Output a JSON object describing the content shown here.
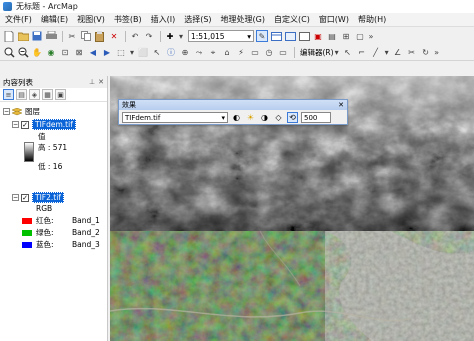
{
  "window": {
    "title": "无标题 - ArcMap"
  },
  "menu": [
    "文件(F)",
    "编辑(E)",
    "视图(V)",
    "书签(B)",
    "插入(I)",
    "选择(S)",
    "地理处理(G)",
    "自定义(C)",
    "窗口(W)",
    "帮助(H)"
  ],
  "toolbar": {
    "scale_value": "1:51,015",
    "editor_label": "编辑器(R)"
  },
  "toc": {
    "title": "内容列表",
    "layers_label": "图层",
    "layer1": {
      "name": "TIFdem.tif",
      "value_label": "值",
      "high": "高 : 571",
      "low": "低 : 16"
    },
    "layer2": {
      "name": "TIF2.tif",
      "rgb_label": "RGB",
      "bands": [
        {
          "label": "红色:",
          "band": "Band_1",
          "color": "#ff0000"
        },
        {
          "label": "绿色:",
          "band": "Band_2",
          "color": "#00c000"
        },
        {
          "label": "蓝色:",
          "band": "Band_3",
          "color": "#0000ff"
        }
      ]
    }
  },
  "effects": {
    "title": "效果",
    "layer": "TIFdem.tif",
    "value": "500"
  }
}
